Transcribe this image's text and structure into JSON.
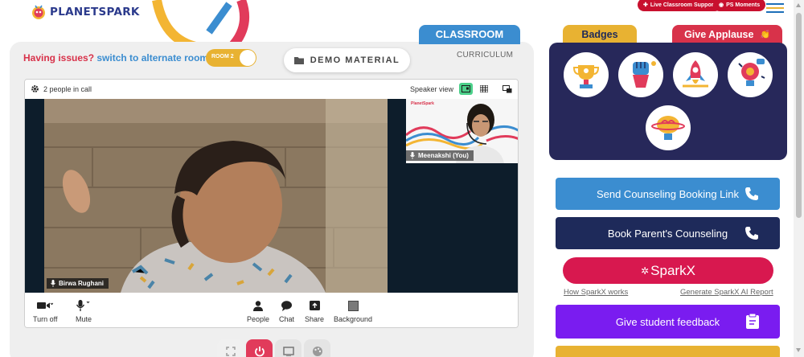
{
  "brand": {
    "name": "PLANETSPARK"
  },
  "header": {
    "support_label": "Live Classroom Support",
    "moments_label": "PS Moments"
  },
  "classroom": {
    "tab_classroom": "CLASSROOM",
    "tab_curriculum": "CURRICULUM",
    "issue_text": "Having issues?",
    "switch_text": "switch to alternate room",
    "room_toggle": "ROOM 2",
    "demo_material": "DEMO MATERIAL"
  },
  "call": {
    "people_count": "2 people in call",
    "speaker_view": "Speaker view",
    "main_participant": "Birwa Rughani",
    "self_participant": "Meenakshi (You)",
    "pip_logo": "PlanetSpark",
    "controls": [
      {
        "icon": "video-camera-icon",
        "label": "Turn off"
      },
      {
        "icon": "microphone-icon",
        "label": "Mute"
      },
      {
        "icon": "people-icon",
        "label": "People"
      },
      {
        "icon": "chat-icon",
        "label": "Chat"
      },
      {
        "icon": "share-icon",
        "label": "Share"
      },
      {
        "icon": "background-icon",
        "label": "Background"
      }
    ]
  },
  "bottom_tools": [
    "expand-icon",
    "power-icon",
    "whiteboard-icon",
    "palette-icon"
  ],
  "sidebar": {
    "tab_badges": "Badges",
    "tab_applause": "Give Applause",
    "badges": [
      "trophy-badge",
      "fist-badge",
      "rocket-badge",
      "idea-badge",
      "brain-badge"
    ],
    "actions": {
      "counseling_link": "Send Counseling Booking Link",
      "parent_counseling": "Book Parent's Counseling",
      "sparkx": "SparkX",
      "how_sparkx": "How SparkX works",
      "generate_report": "Generate SparkX AI Report",
      "student_feedback": "Give student feedback"
    }
  },
  "colors": {
    "brand_blue": "#3b8dd0",
    "brand_red": "#d8324a",
    "brand_yellow": "#e8b232",
    "navy": "#27285a",
    "sparkx_pink": "#d8184f",
    "feedback_purple": "#7a1cf0"
  }
}
